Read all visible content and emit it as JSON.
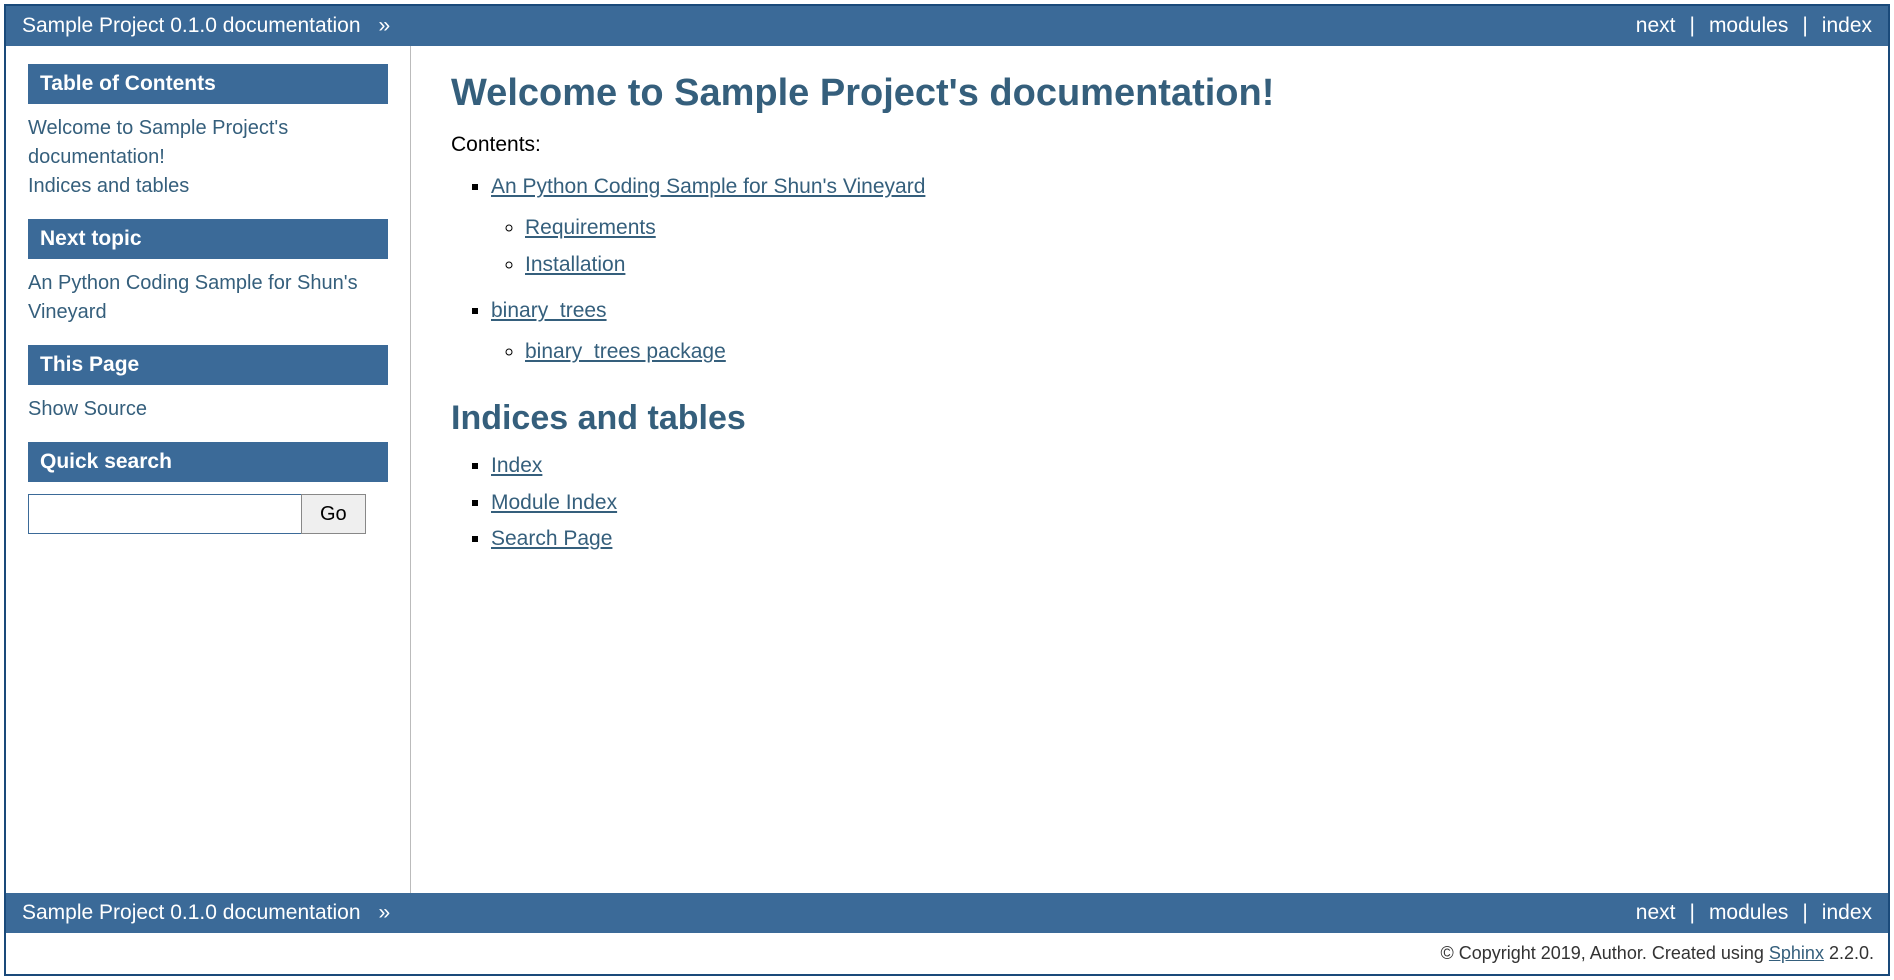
{
  "relbar": {
    "title": "Sample Project 0.1.0 documentation",
    "raquo": "»",
    "links": {
      "next": "next",
      "modules": "modules",
      "index": "index"
    }
  },
  "sidebar": {
    "toc": {
      "heading": "Table of Contents",
      "items": [
        "Welcome to Sample Project's documentation!",
        "Indices and tables"
      ]
    },
    "next_topic": {
      "heading": "Next topic",
      "link": "An Python Coding Sample for Shun's Vineyard"
    },
    "this_page": {
      "heading": "This Page",
      "show_source": "Show Source"
    },
    "search": {
      "heading": "Quick search",
      "placeholder": "",
      "button": "Go"
    }
  },
  "main": {
    "h1": "Welcome to Sample Project's documentation!",
    "contents_label": "Contents:",
    "toctree": [
      {
        "label": "An Python Coding Sample for Shun's Vineyard",
        "children": [
          {
            "label": "Requirements"
          },
          {
            "label": "Installation"
          }
        ]
      },
      {
        "label": "binary_trees",
        "children": [
          {
            "label": "binary_trees package"
          }
        ]
      }
    ],
    "indices": {
      "heading": "Indices and tables",
      "items": [
        "Index",
        "Module Index",
        "Search Page"
      ]
    }
  },
  "footer": {
    "copyright": "© Copyright 2019, Author. Created using ",
    "sphinx_label": "Sphinx",
    "sphinx_version": " 2.2.0."
  }
}
